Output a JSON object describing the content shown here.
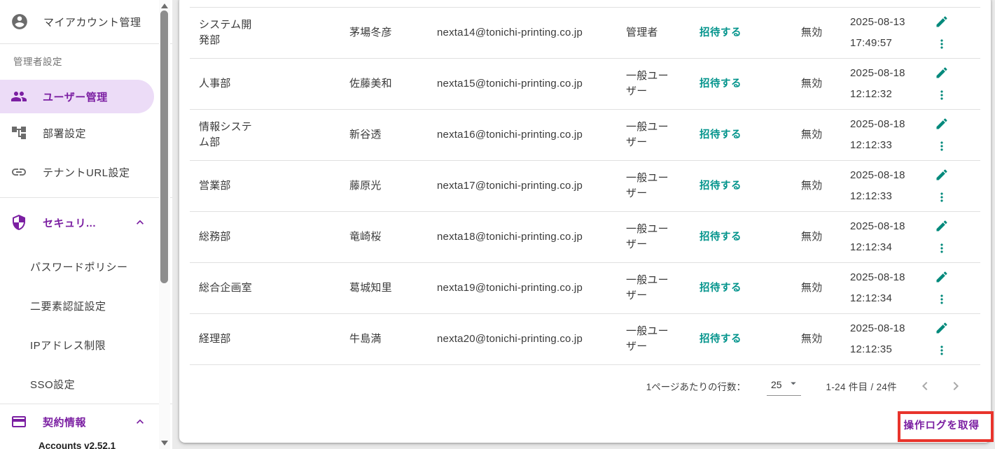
{
  "colors": {
    "accent_purple": "#7b1fa2",
    "active_item_bg": "#ecdcf7",
    "teal_accent": "#00938b",
    "annotation_red": "#e8342c",
    "divider": "#e0e0e0"
  },
  "icons": {
    "account": "account-circle-icon",
    "users": "people-icon",
    "departments": "org-tree-icon",
    "tenant_url": "link-icon",
    "security": "shield-icon",
    "contract": "credit-card-icon",
    "collapse": "chevron-up-icon",
    "edit": "pencil-icon",
    "more": "kebab-menu-icon",
    "select_caret": "caret-down-icon",
    "prev": "chevron-left-icon",
    "next": "chevron-right-icon"
  },
  "sidebar": {
    "account_label": "マイアカウント管理",
    "section_label": "管理者設定",
    "items": [
      {
        "label": "ユーザー管理",
        "active": true
      },
      {
        "label": "部署設定",
        "active": false
      },
      {
        "label": "テナントURL設定",
        "active": false
      }
    ],
    "security": {
      "label": "セキュリ...",
      "items": [
        "パスワードポリシー",
        "二要素認証設定",
        "IPアドレス制限",
        "SSO設定"
      ]
    },
    "contract": {
      "label": "契約情報"
    },
    "version": "Accounts v2.52.1"
  },
  "table": {
    "rows": [
      {
        "department": "システム開発部",
        "name": "茅場冬彦",
        "email": "nexta14@tonichi-printing.co.jp",
        "role": "管理者",
        "invite": "招待する",
        "status": "無効",
        "date": "2025-08-13",
        "time": "17:49:57"
      },
      {
        "department": "人事部",
        "name": "佐藤美和",
        "email": "nexta15@tonichi-printing.co.jp",
        "role": "一般ユーザー",
        "invite": "招待する",
        "status": "無効",
        "date": "2025-08-18",
        "time": "12:12:32"
      },
      {
        "department": "情報システム部",
        "name": "新谷透",
        "email": "nexta16@tonichi-printing.co.jp",
        "role": "一般ユーザー",
        "invite": "招待する",
        "status": "無効",
        "date": "2025-08-18",
        "time": "12:12:33"
      },
      {
        "department": "営業部",
        "name": "藤原光",
        "email": "nexta17@tonichi-printing.co.jp",
        "role": "一般ユーザー",
        "invite": "招待する",
        "status": "無効",
        "date": "2025-08-18",
        "time": "12:12:33"
      },
      {
        "department": "総務部",
        "name": "竜崎桜",
        "email": "nexta18@tonichi-printing.co.jp",
        "role": "一般ユーザー",
        "invite": "招待する",
        "status": "無効",
        "date": "2025-08-18",
        "time": "12:12:34"
      },
      {
        "department": "総合企画室",
        "name": "葛城知里",
        "email": "nexta19@tonichi-printing.co.jp",
        "role": "一般ユーザー",
        "invite": "招待する",
        "status": "無効",
        "date": "2025-08-18",
        "time": "12:12:34"
      },
      {
        "department": "経理部",
        "name": "牛島満",
        "email": "nexta20@tonichi-printing.co.jp",
        "role": "一般ユーザー",
        "invite": "招待する",
        "status": "無効",
        "date": "2025-08-18",
        "time": "12:12:35"
      }
    ]
  },
  "pagination": {
    "rows_per_page_label": "1ページあたりの行数：",
    "rows_per_page_value": "25",
    "range_label": "1-24 件目 / 24件"
  },
  "footer": {
    "action_label": "操作ログを取得"
  }
}
